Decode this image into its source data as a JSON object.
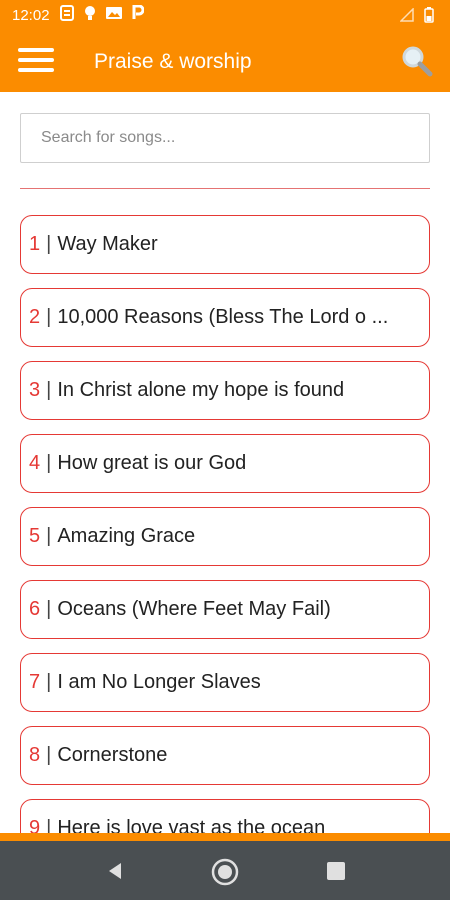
{
  "status_bar": {
    "time": "12:02"
  },
  "app_bar": {
    "title": "Praise & worship"
  },
  "search": {
    "placeholder": "Search for songs..."
  },
  "songs": [
    {
      "number": "1",
      "separator": "|",
      "title": "Way Maker"
    },
    {
      "number": "2",
      "separator": "|",
      "title": "10,000 Reasons (Bless The Lord o ..."
    },
    {
      "number": "3",
      "separator": "|",
      "title": "In Christ alone my hope is found"
    },
    {
      "number": "4",
      "separator": "|",
      "title": "How great is our God"
    },
    {
      "number": "5",
      "separator": "|",
      "title": "Amazing Grace"
    },
    {
      "number": "6",
      "separator": "|",
      "title": "Oceans (Where Feet May Fail)"
    },
    {
      "number": "7",
      "separator": "|",
      "title": "I am No Longer Slaves"
    },
    {
      "number": "8",
      "separator": "|",
      "title": "Cornerstone"
    },
    {
      "number": "9",
      "separator": "|",
      "title": "Here is love vast as the ocean"
    }
  ],
  "colors": {
    "accent": "#fb8c00",
    "item_border": "#e53935",
    "nav_bar": "#4a4f52"
  },
  "icons": {
    "menu": "menu-icon",
    "search": "search-icon",
    "back": "back-icon",
    "home": "home-icon",
    "recents": "recents-icon"
  }
}
